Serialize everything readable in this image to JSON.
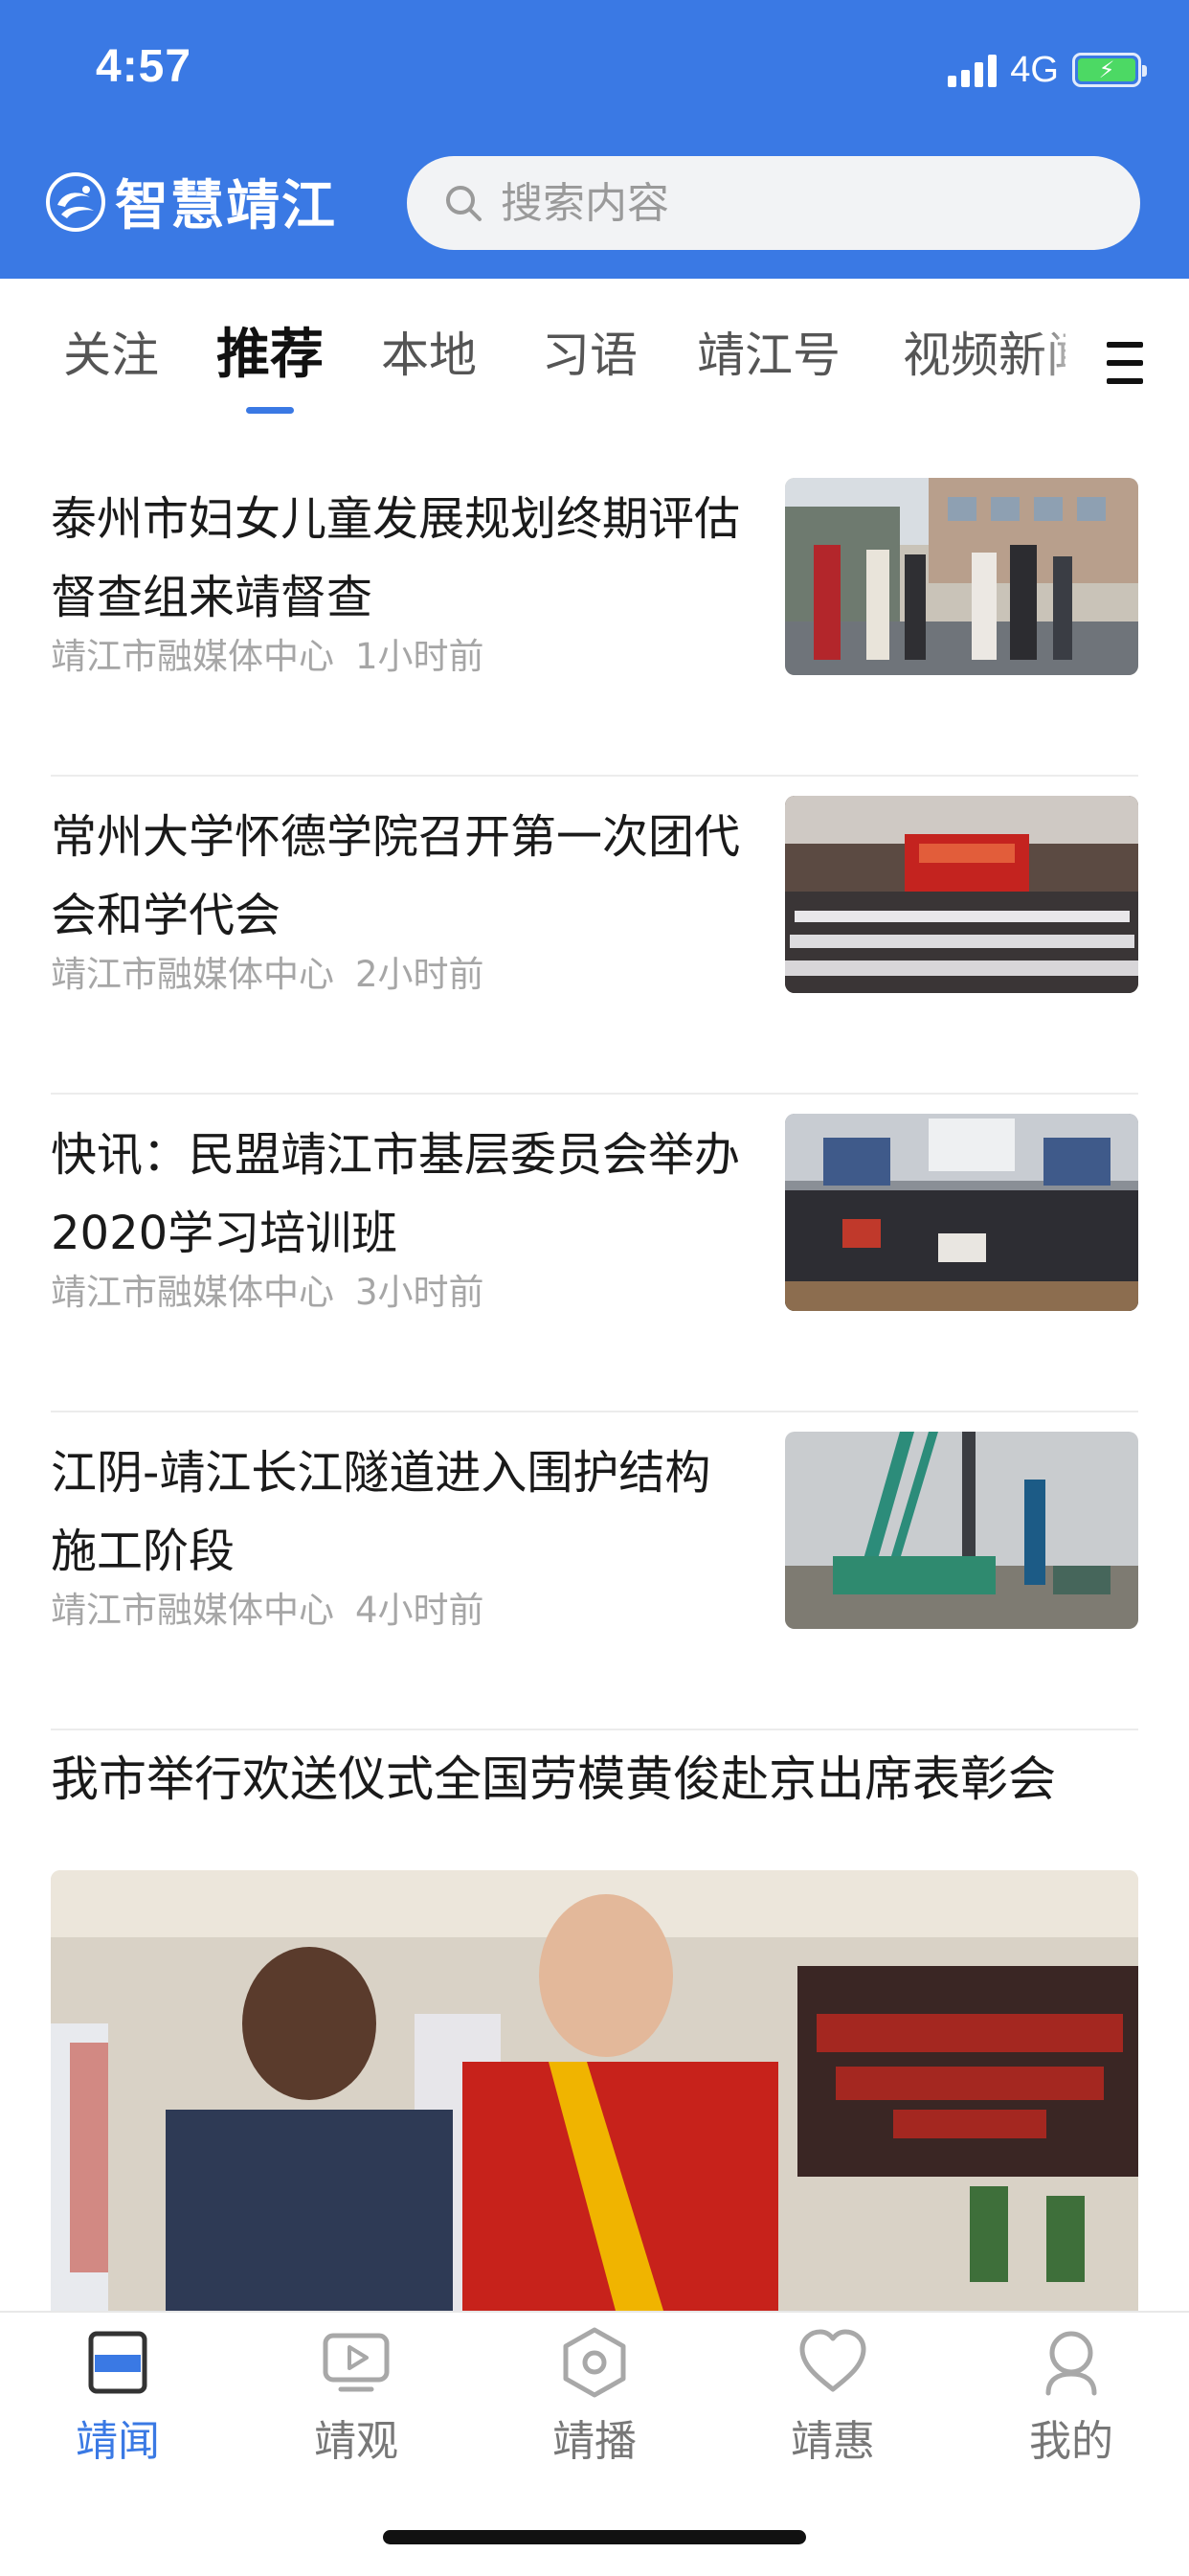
{
  "status_bar": {
    "time": "4:57",
    "network": "4G"
  },
  "header": {
    "app_title": "智慧靖江",
    "search_placeholder": "搜索内容"
  },
  "channel_tabs": [
    {
      "label": "关注"
    },
    {
      "label": "推荐",
      "active": true
    },
    {
      "label": "本地"
    },
    {
      "label": "习语"
    },
    {
      "label": "靖江号"
    },
    {
      "label": "视频新闻"
    }
  ],
  "news": [
    {
      "title": "泰州市妇女儿童发展规划终期评估督查组来靖督查",
      "source": "靖江市融媒体中心",
      "time": "1小时前",
      "image": "officials-group-photo"
    },
    {
      "title": "常州大学怀德学院召开第一次团代会和学代会",
      "source": "靖江市融媒体中心",
      "time": "2小时前",
      "image": "conference-hall-red-stage"
    },
    {
      "title": "快讯：民盟靖江市基层委员会举办2020学习培训班",
      "source": "靖江市融媒体中心",
      "time": "3小时前",
      "image": "training-class-audience"
    },
    {
      "title": "江阴-靖江长江隧道进入围护结构施工阶段",
      "source": "靖江市融媒体中心",
      "time": "4小时前",
      "image": "construction-pile-driver"
    }
  ],
  "featured": {
    "title": "我市举行欢送仪式全国劳模黄俊赴京出席表彰会",
    "image": "model-worker-ceremony"
  },
  "bottom_tabs": [
    {
      "label": "靖闻",
      "icon": "news-icon",
      "active": true
    },
    {
      "label": "靖观",
      "icon": "video-icon"
    },
    {
      "label": "靖播",
      "icon": "broadcast-icon"
    },
    {
      "label": "靖惠",
      "icon": "heart-icon"
    },
    {
      "label": "我的",
      "icon": "profile-icon"
    }
  ],
  "colors": {
    "primary": "#3a79e4",
    "header_bg": "#3a79e4",
    "text": "#1a1a1a",
    "meta": "#a6a6a6"
  }
}
